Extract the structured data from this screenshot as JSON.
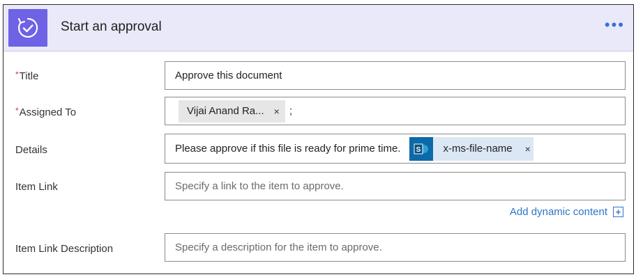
{
  "header": {
    "title": "Start an approval",
    "icon": "approval-check-icon",
    "more_label": "•••",
    "accent": "#6e62e5",
    "background": "#e9e9fa"
  },
  "fields": {
    "title": {
      "required_mark": "*",
      "label": "Title",
      "value": "Approve this document"
    },
    "assigned_to": {
      "required_mark": "*",
      "label": "Assigned To",
      "token": "Vijai Anand Ra...",
      "token_close": "×",
      "separator": ";"
    },
    "details": {
      "label": "Details",
      "value": "Please approve if this file is ready for prime time.",
      "dynamic_token": "x-ms-file-name",
      "dynamic_token_icon": "sharepoint-icon",
      "dynamic_token_close": "×"
    },
    "item_link": {
      "label": "Item Link",
      "placeholder": "Specify a link to the item to approve."
    },
    "item_link_description": {
      "label": "Item Link Description",
      "placeholder": "Specify a description for the item to approve."
    }
  },
  "add_dynamic_content": {
    "label": "Add dynamic content",
    "icon_glyph": "+"
  }
}
